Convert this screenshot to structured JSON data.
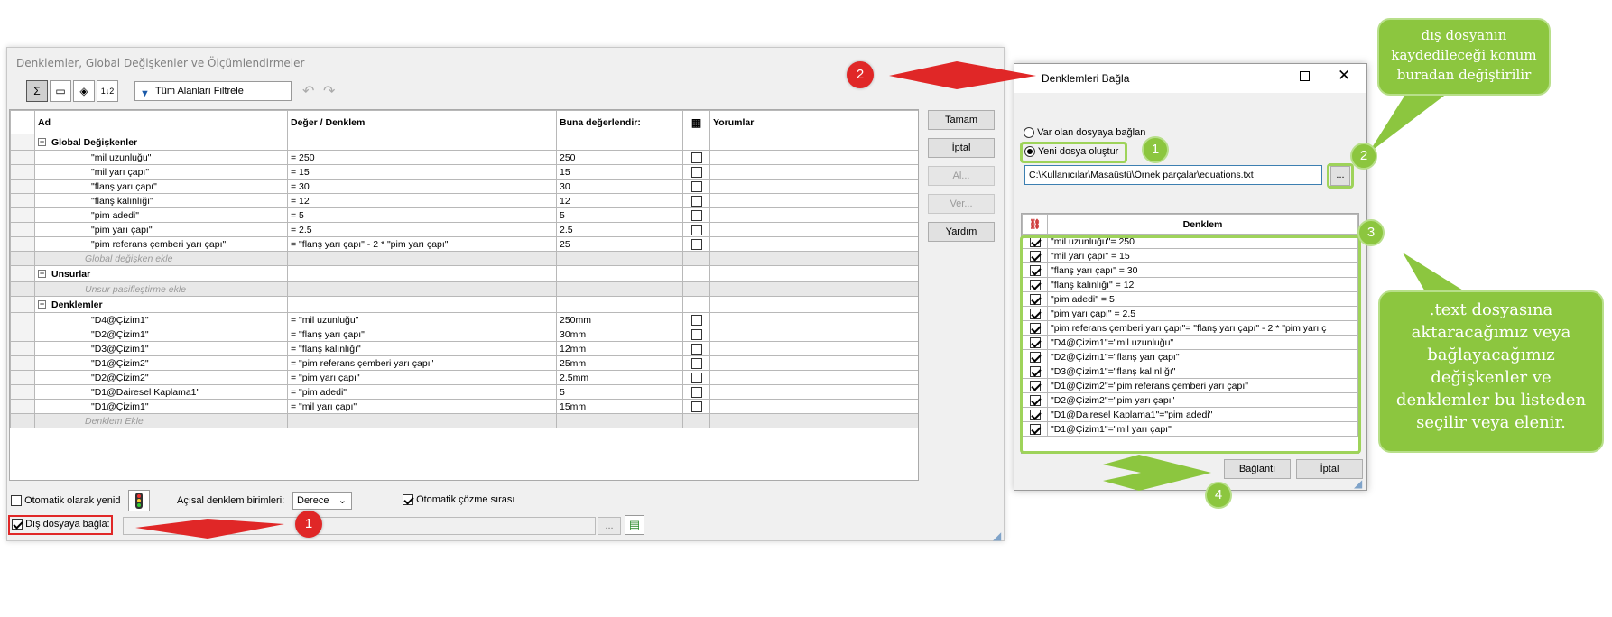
{
  "main": {
    "title": "Denklemler, Global Değişkenler ve Ölçümlendirmeler",
    "filter": "Tüm Alanları Filtrele",
    "headers": {
      "name": "Ad",
      "value": "Değer / Denklem",
      "eval": "Buna değerlendir:",
      "comments": "Yorumlar"
    },
    "sections": {
      "global": "Global Değişkenler",
      "features": "Unsurlar",
      "equations": "Denklemler"
    },
    "globals": [
      {
        "name": "\"mil uzunluğu\"",
        "value": "= 250",
        "eval": "250"
      },
      {
        "name": "\"mil yarı çapı\"",
        "value": "= 15",
        "eval": "15"
      },
      {
        "name": "\"flanş yarı çapı\"",
        "value": "= 30",
        "eval": "30"
      },
      {
        "name": "\"flanş kalınlığı\"",
        "value": "= 12",
        "eval": "12"
      },
      {
        "name": "\"pim adedi\"",
        "value": "= 5",
        "eval": "5"
      },
      {
        "name": "\"pim yarı çapı\"",
        "value": "= 2.5",
        "eval": "2.5"
      },
      {
        "name": "\"pim referans çemberi yarı çapı\"",
        "value": "= \"flanş yarı çapı\" - 2 * \"pim yarı çapı\"",
        "eval": "25"
      }
    ],
    "add_global": "Global değişken ekle",
    "add_feature": "Unsur pasifleştirme ekle",
    "equations": [
      {
        "name": "\"D4@Çizim1\"",
        "value": "= \"mil uzunluğu\"",
        "eval": "250mm"
      },
      {
        "name": "\"D2@Çizim1\"",
        "value": "= \"flanş yarı çapı\"",
        "eval": "30mm"
      },
      {
        "name": "\"D3@Çizim1\"",
        "value": "= \"flanş kalınlığı\"",
        "eval": "12mm"
      },
      {
        "name": "\"D1@Çizim2\"",
        "value": "= \"pim referans çemberi yarı çapı\"",
        "eval": "25mm"
      },
      {
        "name": "\"D2@Çizim2\"",
        "value": "= \"pim yarı çapı\"",
        "eval": "2.5mm"
      },
      {
        "name": "\"D1@Dairesel Kaplama1\"",
        "value": "= \"pim adedi\"",
        "eval": "5"
      },
      {
        "name": "\"D1@Çizim1\"",
        "value": "= \"mil yarı çapı\"",
        "eval": "15mm"
      }
    ],
    "add_equation": "Denklem Ekle",
    "buttons": {
      "ok": "Tamam",
      "cancel": "İptal",
      "import": "Al...",
      "export": "Ver...",
      "help": "Yardım"
    },
    "auto_rebuild": "Otomatik olarak yenid",
    "angular_label": "Açısal denklem birimleri:",
    "angular_value": "Derece",
    "auto_order": "Otomatik çözme sırası",
    "link_external": "Dış dosyaya bağla:",
    "browse": "..."
  },
  "link_dialog": {
    "title": "Denklemleri Bağla",
    "radio_existing": "Var olan dosyaya bağlan",
    "radio_new": "Yeni dosya oluştur",
    "path": "C:\\Kullanıcılar\\Masaüstü\\Örnek parçalar\\equations.txt",
    "browse": "...",
    "col_header": "Denklem",
    "items": [
      "\"mil uzunluğu\"= 250",
      "\"mil yarı çapı\" = 15",
      "\"flanş yarı çapı\" = 30",
      "\"flanş kalınlığı\" = 12",
      "\"pim adedi\" = 5",
      "\"pim yarı çapı\" = 2.5",
      "\"pim referans çemberi yarı çapı\"= \"flanş yarı çapı\" - 2 * \"pim yarı ç",
      "\"D4@Çizim1\"=\"mil uzunluğu\"",
      "\"D2@Çizim1\"=\"flanş yarı çapı\"",
      "\"D3@Çizim1\"=\"flanş kalınlığı\"",
      "\"D1@Çizim2\"=\"pim referans çemberi yarı çapı\"",
      "\"D2@Çizim2\"=\"pim yarı çapı\"",
      "\"D1@Dairesel Kaplama1\"=\"pim adedi\"",
      "\"D1@Çizim1\"=\"mil yarı çapı\""
    ],
    "btn_link": "Bağlantı",
    "btn_cancel": "İptal"
  },
  "callouts": {
    "top": "dış dosyanın kaydedileceği konum buradan değiştirilir",
    "right": ".text dosyasına aktaracağımız veya bağlayacağımız değişkenler ve denklemler bu listeden seçilir veya elenir.",
    "n1": "1",
    "n2": "2",
    "n3": "3",
    "n4": "4"
  },
  "colors": {
    "callout_green": "#8cc63f",
    "marker_red": "#e02727"
  }
}
